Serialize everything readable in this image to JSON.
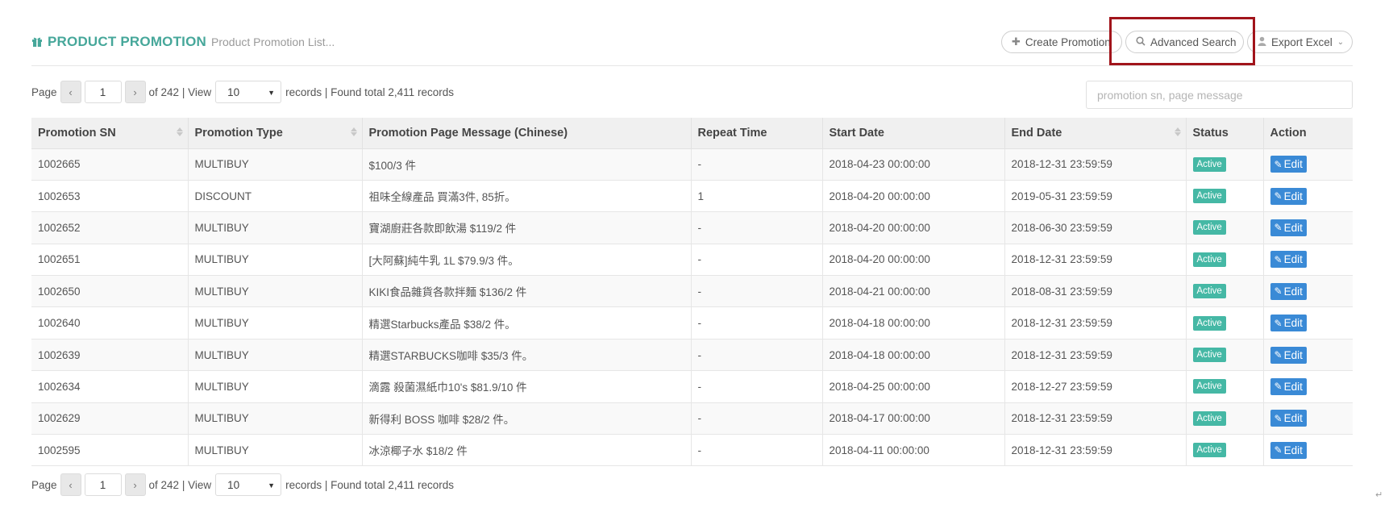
{
  "header": {
    "title": "PRODUCT PROMOTION",
    "subtitle": "Product Promotion List...",
    "icon": "gift-icon",
    "accent_color": "#46a79a"
  },
  "actions": {
    "create_label": "Create Promotion",
    "advanced_label": "Advanced Search",
    "export_label": "Export Excel"
  },
  "pager": {
    "page_label": "Page",
    "current_page": "1",
    "of_text": "of 242 | View",
    "per_page": "10",
    "records_text": "records | Found total 2,411 records"
  },
  "search": {
    "placeholder": "promotion sn, page message"
  },
  "table": {
    "columns": [
      "Promotion SN",
      "Promotion Type",
      "Promotion Page Message (Chinese)",
      "Repeat Time",
      "Start Date",
      "End Date",
      "Status",
      "Action"
    ],
    "rows": [
      {
        "sn": "1002665",
        "type": "MULTIBUY",
        "message": "$100/3 件",
        "repeat": "-",
        "start": "2018-04-23 00:00:00",
        "end": "2018-12-31 23:59:59",
        "status": "Active",
        "action": "Edit"
      },
      {
        "sn": "1002653",
        "type": "DISCOUNT",
        "message": "祖味全線產品 買滿3件, 85折。",
        "repeat": "1",
        "start": "2018-04-20 00:00:00",
        "end": "2019-05-31 23:59:59",
        "status": "Active",
        "action": "Edit"
      },
      {
        "sn": "1002652",
        "type": "MULTIBUY",
        "message": "寶湖廚莊各款即飲湯 $119/2 件",
        "repeat": "-",
        "start": "2018-04-20 00:00:00",
        "end": "2018-06-30 23:59:59",
        "status": "Active",
        "action": "Edit"
      },
      {
        "sn": "1002651",
        "type": "MULTIBUY",
        "message": "[大阿蘇]純牛乳 1L $79.9/3 件。",
        "repeat": "-",
        "start": "2018-04-20 00:00:00",
        "end": "2018-12-31 23:59:59",
        "status": "Active",
        "action": "Edit"
      },
      {
        "sn": "1002650",
        "type": "MULTIBUY",
        "message": "KIKI食品雜貨各款拌麵 $136/2 件",
        "repeat": "-",
        "start": "2018-04-21 00:00:00",
        "end": "2018-08-31 23:59:59",
        "status": "Active",
        "action": "Edit"
      },
      {
        "sn": "1002640",
        "type": "MULTIBUY",
        "message": "精選Starbucks產品 $38/2 件。",
        "repeat": "-",
        "start": "2018-04-18 00:00:00",
        "end": "2018-12-31 23:59:59",
        "status": "Active",
        "action": "Edit"
      },
      {
        "sn": "1002639",
        "type": "MULTIBUY",
        "message": "精選STARBUCKS咖啡 $35/3 件。",
        "repeat": "-",
        "start": "2018-04-18 00:00:00",
        "end": "2018-12-31 23:59:59",
        "status": "Active",
        "action": "Edit"
      },
      {
        "sn": "1002634",
        "type": "MULTIBUY",
        "message": "滴露 殺菌濕紙巾10's $81.9/10 件",
        "repeat": "-",
        "start": "2018-04-25 00:00:00",
        "end": "2018-12-27 23:59:59",
        "status": "Active",
        "action": "Edit"
      },
      {
        "sn": "1002629",
        "type": "MULTIBUY",
        "message": "新得利 BOSS 咖啡 $28/2 件。",
        "repeat": "-",
        "start": "2018-04-17 00:00:00",
        "end": "2018-12-31 23:59:59",
        "status": "Active",
        "action": "Edit"
      },
      {
        "sn": "1002595",
        "type": "MULTIBUY",
        "message": "冰涼椰子水 $18/2 件",
        "repeat": "-",
        "start": "2018-04-11 00:00:00",
        "end": "2018-12-31 23:59:59",
        "status": "Active",
        "action": "Edit"
      }
    ]
  },
  "colors": {
    "status_active": "#45b8a5",
    "edit_button": "#3a8ad6",
    "highlight_box": "#a1141b"
  }
}
